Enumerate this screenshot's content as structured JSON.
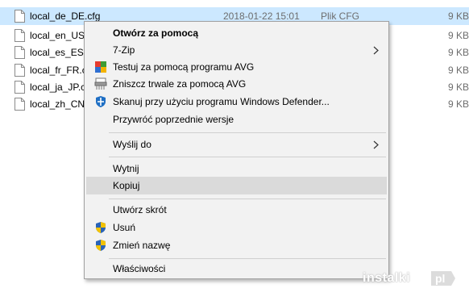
{
  "files": [
    {
      "name": "local_de_DE.cfg",
      "date": "2018-01-22 15:01",
      "type": "Plik CFG",
      "size": "9 KB",
      "selected": true
    },
    {
      "name": "local_en_US.c",
      "date": "",
      "type": "",
      "size": "9 KB",
      "selected": false
    },
    {
      "name": "local_es_ES.c",
      "date": "",
      "type": "",
      "size": "9 KB",
      "selected": false
    },
    {
      "name": "local_fr_FR.cf",
      "date": "",
      "type": "",
      "size": "9 KB",
      "selected": false
    },
    {
      "name": "local_ja_JP.cf",
      "date": "",
      "type": "",
      "size": "9 KB",
      "selected": false
    },
    {
      "name": "local_zh_CN.",
      "date": "",
      "type": "",
      "size": "9 KB",
      "selected": false
    }
  ],
  "context_menu": {
    "open_with": "Otwórz za pomocą",
    "seven_zip": "7-Zip",
    "avg_scan": "Testuj za pomocą programu AVG",
    "avg_shred": "Zniszcz trwale za pomocą AVG",
    "defender_scan": "Skanuj przy użyciu programu Windows Defender...",
    "restore_versions": "Przywróć poprzednie wersje",
    "send_to": "Wyślij do",
    "cut": "Wytnij",
    "copy": "Kopiuj",
    "create_shortcut": "Utwórz skrót",
    "delete": "Usuń",
    "rename": "Zmień nazwę",
    "properties": "Właściwości"
  },
  "watermark": {
    "text": "instalki",
    "badge": "pl"
  },
  "colors": {
    "selection": "#cce8ff",
    "menu_bg": "#f2f2f2",
    "menu_hover": "#dadada",
    "shield_blue": "#2a64b8",
    "shield_yellow": "#f2c200",
    "defender_blue": "#1f6fc4"
  },
  "icons": {
    "file": "document-icon",
    "submenu": "chevron-right-icon",
    "avg": "avg-icon",
    "shredder": "shredder-icon",
    "defender": "windows-defender-icon",
    "uac": "uac-shield-icon"
  }
}
